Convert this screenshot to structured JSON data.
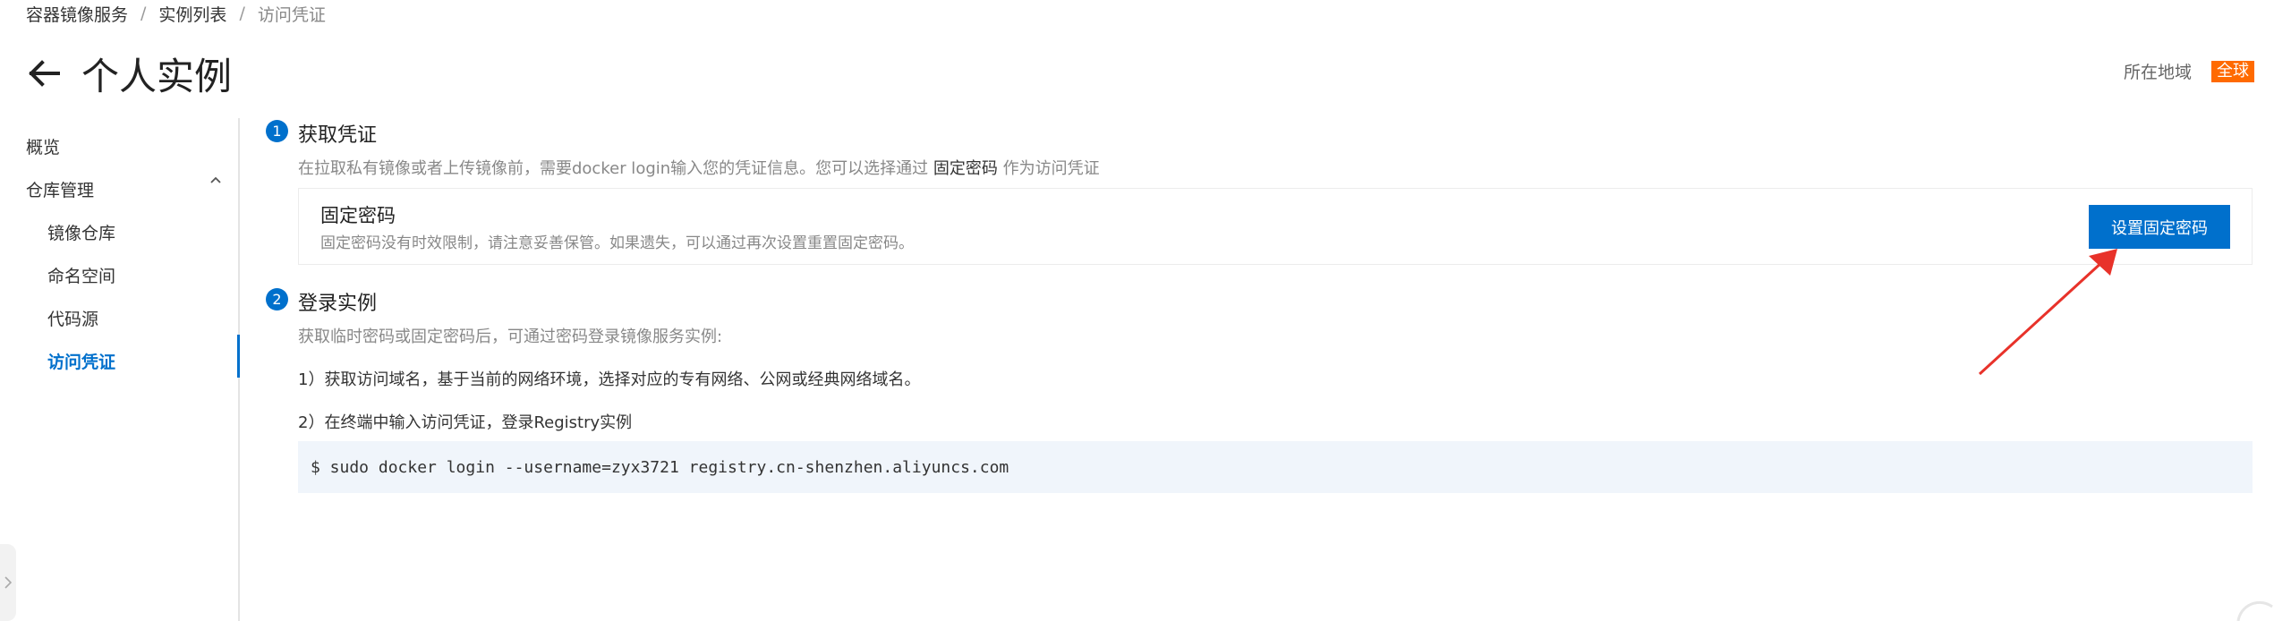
{
  "breadcrumb": {
    "items": [
      "容器镜像服务",
      "实例列表"
    ],
    "current": "访问凭证",
    "separator": "/"
  },
  "header": {
    "title": "个人实例",
    "region_label": "所在地域",
    "region_value": "全球"
  },
  "sidebar": {
    "overview": "概览",
    "repo_management": "仓库管理",
    "items": [
      {
        "label": "镜像仓库"
      },
      {
        "label": "命名空间"
      },
      {
        "label": "代码源"
      },
      {
        "label": "访问凭证",
        "active": true
      }
    ]
  },
  "step1": {
    "number": "1",
    "title": "获取凭证",
    "desc_prefix": "在拉取私有镜像或者上传镜像前，需要docker login输入您的凭证信息。您可以选择通过",
    "desc_strong": "固定密码",
    "desc_suffix": "作为访问凭证",
    "box_title": "固定密码",
    "box_desc": "固定密码没有时效限制，请注意妥善保管。如果遗失，可以通过再次设置重置固定密码。",
    "button_label": "设置固定密码"
  },
  "step2": {
    "number": "2",
    "title": "登录实例",
    "desc": "获取临时密码或固定密码后，可通过密码登录镜像服务实例:",
    "line1": "1）获取访问域名，基于当前的网络环境，选择对应的专有网络、公网或经典网络域名。",
    "line2": "2）在终端中输入访问凭证，登录Registry实例",
    "command": "$ sudo docker login --username=zyx3721 registry.cn-shenzhen.aliyuncs.com"
  },
  "colors": {
    "accent": "#0070cc",
    "region_badge": "#ff6a00",
    "annotation_arrow": "#e8322a",
    "code_bg": "#f0f5fb"
  },
  "icons": {
    "back": "arrow-left-icon",
    "collapse": "chevron-up-icon",
    "sidebar_toggle": "chevron-right-icon"
  }
}
